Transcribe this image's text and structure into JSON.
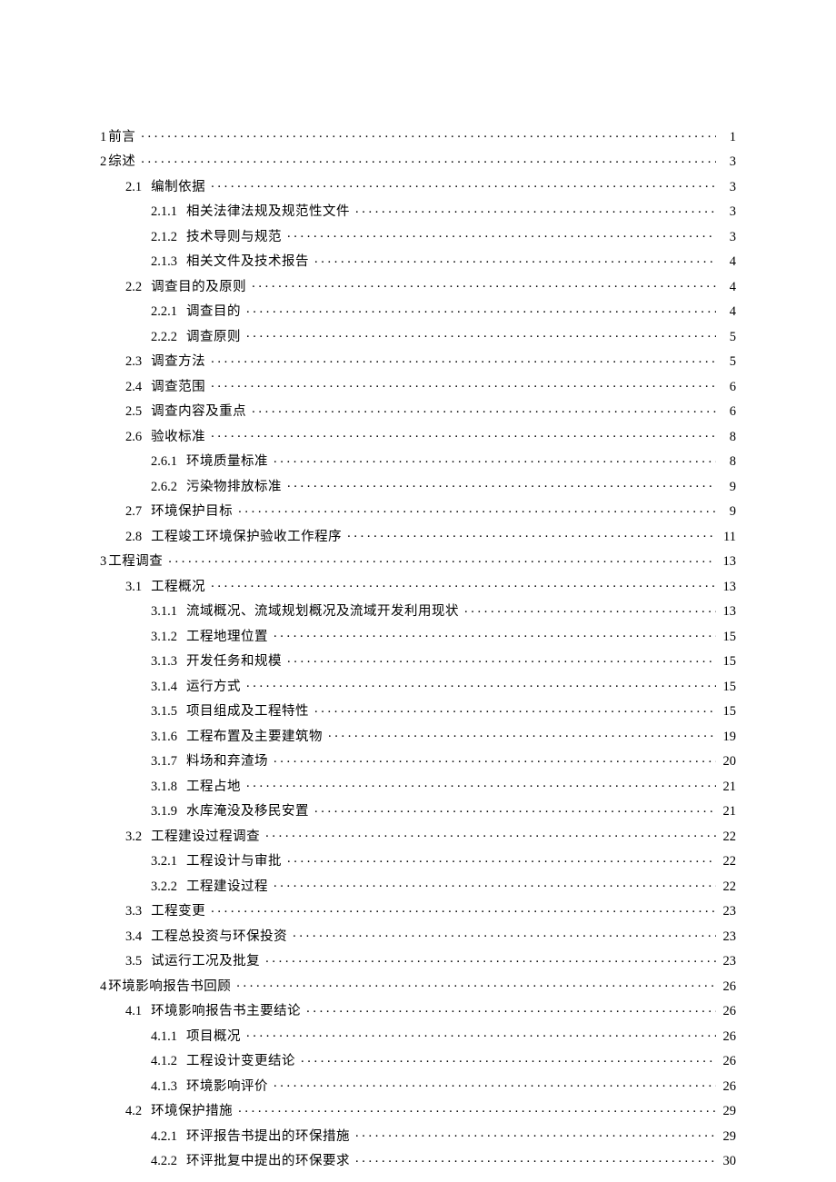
{
  "toc": [
    {
      "level": 0,
      "num": "1",
      "label": "前言",
      "page": "1",
      "nosp": true
    },
    {
      "level": 0,
      "num": "2",
      "label": "综述",
      "page": "3",
      "nosp": true
    },
    {
      "level": 1,
      "num": "2.1",
      "label": "编制依据",
      "page": "3"
    },
    {
      "level": 2,
      "num": "2.1.1",
      "label": "相关法律法规及规范性文件",
      "page": "3"
    },
    {
      "level": 2,
      "num": "2.1.2",
      "label": "技术导则与规范",
      "page": "3"
    },
    {
      "level": 2,
      "num": "2.1.3",
      "label": "相关文件及技术报告",
      "page": "4"
    },
    {
      "level": 1,
      "num": "2.2",
      "label": "调查目的及原则",
      "page": "4"
    },
    {
      "level": 2,
      "num": "2.2.1",
      "label": "调查目的",
      "page": "4"
    },
    {
      "level": 2,
      "num": "2.2.2",
      "label": "调查原则",
      "page": "5"
    },
    {
      "level": 1,
      "num": "2.3",
      "label": "调查方法",
      "page": "5"
    },
    {
      "level": 1,
      "num": "2.4",
      "label": "调查范围",
      "page": "6"
    },
    {
      "level": 1,
      "num": "2.5",
      "label": "调查内容及重点",
      "page": "6"
    },
    {
      "level": 1,
      "num": "2.6",
      "label": "验收标准",
      "page": "8"
    },
    {
      "level": 2,
      "num": "2.6.1",
      "label": "环境质量标准",
      "page": "8"
    },
    {
      "level": 2,
      "num": "2.6.2",
      "label": "污染物排放标准",
      "page": "9"
    },
    {
      "level": 1,
      "num": "2.7",
      "label": "环境保护目标",
      "page": "9"
    },
    {
      "level": 1,
      "num": "2.8",
      "label": "工程竣工环境保护验收工作程序",
      "page": "11"
    },
    {
      "level": 0,
      "num": "3",
      "label": "工程调查",
      "page": "13",
      "nosp": true
    },
    {
      "level": 1,
      "num": "3.1",
      "label": "工程概况",
      "page": "13"
    },
    {
      "level": 2,
      "num": "3.1.1",
      "label": "流域概况、流域规划概况及流域开发利用现状",
      "page": "13"
    },
    {
      "level": 2,
      "num": "3.1.2",
      "label": "工程地理位置",
      "page": "15"
    },
    {
      "level": 2,
      "num": "3.1.3",
      "label": "开发任务和规模",
      "page": "15"
    },
    {
      "level": 2,
      "num": "3.1.4",
      "label": "运行方式",
      "page": "15"
    },
    {
      "level": 2,
      "num": "3.1.5",
      "label": "项目组成及工程特性",
      "page": "15"
    },
    {
      "level": 2,
      "num": "3.1.6",
      "label": "工程布置及主要建筑物",
      "page": "19"
    },
    {
      "level": 2,
      "num": "3.1.7",
      "label": "料场和弃渣场",
      "page": "20"
    },
    {
      "level": 2,
      "num": "3.1.8",
      "label": "工程占地",
      "page": "21"
    },
    {
      "level": 2,
      "num": "3.1.9",
      "label": "水库淹没及移民安置",
      "page": "21"
    },
    {
      "level": 1,
      "num": "3.2",
      "label": "工程建设过程调查",
      "page": "22"
    },
    {
      "level": 2,
      "num": "3.2.1",
      "label": "工程设计与审批",
      "page": "22"
    },
    {
      "level": 2,
      "num": "3.2.2",
      "label": "工程建设过程",
      "page": "22"
    },
    {
      "level": 1,
      "num": "3.3",
      "label": "工程变更",
      "page": "23"
    },
    {
      "level": 1,
      "num": "3.4",
      "label": "工程总投资与环保投资",
      "page": "23"
    },
    {
      "level": 1,
      "num": "3.5",
      "label": "试运行工况及批复",
      "page": "23"
    },
    {
      "level": 0,
      "num": "4",
      "label": "环境影响报告书回顾",
      "page": "26",
      "nosp": true
    },
    {
      "level": 1,
      "num": "4.1",
      "label": "环境影响报告书主要结论",
      "page": "26"
    },
    {
      "level": 2,
      "num": "4.1.1",
      "label": "项目概况",
      "page": "26"
    },
    {
      "level": 2,
      "num": "4.1.2",
      "label": "工程设计变更结论",
      "page": "26"
    },
    {
      "level": 2,
      "num": "4.1.3",
      "label": "环境影响评价",
      "page": "26"
    },
    {
      "level": 1,
      "num": "4.2",
      "label": "环境保护措施",
      "page": "29"
    },
    {
      "level": 2,
      "num": "4.2.1",
      "label": "环评报告书提出的环保措施",
      "page": "29"
    },
    {
      "level": 2,
      "num": "4.2.2",
      "label": "环评批复中提出的环保要求",
      "page": "30"
    }
  ]
}
